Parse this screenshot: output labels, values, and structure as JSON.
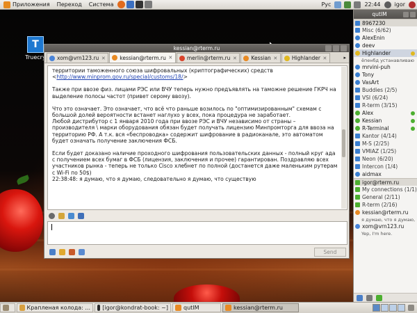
{
  "top_panel": {
    "menus": [
      "Приложения",
      "Переход",
      "Система"
    ],
    "keyboard_layout": "Рус",
    "clock": "22:44",
    "user": "igor"
  },
  "desktop": {
    "icon_label": "Truecry"
  },
  "chat": {
    "window_title": "kessian@rterm.ru",
    "tabs": [
      {
        "label": "xom@vrn123.ru",
        "icon_color": "#4a84d8"
      },
      {
        "label": "kessian@rterm.ru",
        "icon_color": "#e88a24"
      },
      {
        "label": "merlin@rterm.ru",
        "icon_color": "#d9442c"
      },
      {
        "label": "Kessian",
        "icon_color": "#e88a24"
      },
      {
        "label": "Highlander",
        "icon_color": "#e0b820"
      }
    ],
    "log": {
      "p1_pre": "территории таможенного союза шифровальных (криптографических) средств <",
      "p1_link": "http://www.minprom.gov.ru/special/customs/18/",
      "p1_post": ">",
      "p2": "Также при ввозе физ. лицами РЭС или ВЧУ теперь нужно предъявлять на таможне решение ГКРЧ на выделение полосы частот (привет серому ввозу).",
      "p3": "Что это означает. Это означает, что всё что раньше возилось по \"оптимизированным\" схемам с большой долей вероятности встанет наглухо у всех, пока процедура не заработает.",
      "p3b": "Любой дистрибутор с 1 января 2010 года при ввозе РЭС и ВЧУ независимо от страны – производителя \\ марки оборудования обязан будет получать лицензию Минпромторга для ввоза на территорию РФ. А т.к. вся «беспроводка» содержит шифрование в радиоканале, это автоматом будет означать получение заключения ФСБ.",
      "p4": "Если будет доказано наличие проходного шифрования пользовательских данных - полный круг ада с получением всех бумаг в ФСБ (лицензия, заключения и прочее) гарантирован. Поздравляю всех участников рынка - теперь не только Cisco хлебнет по полной (достанется даже маленьким рутерам с Wi-Fi по 50$)",
      "last_line": "22:38:48: я думаю, что я думаю, следовательно я думаю, что существую"
    },
    "send_label": "Send"
  },
  "roster": {
    "title": "qutIM",
    "rows": [
      {
        "kind": "acct",
        "text": "8967230",
        "icon": "#3a7fd0"
      },
      {
        "kind": "grp",
        "text": "Misc (6/62)",
        "icon": "#3a7fd0"
      },
      {
        "kind": "contact",
        "text": "AlexEnin",
        "icon": "#3a7fd0"
      },
      {
        "kind": "contact",
        "text": "deev",
        "icon": "#3a7fd0"
      },
      {
        "kind": "contact-sel",
        "text": "Highlander",
        "icon": "#e0b820",
        "right": "#e0b820"
      },
      {
        "kind": "sub",
        "text": "ёпенбд устанавливаю"
      },
      {
        "kind": "contact",
        "text": "mrvini-puh",
        "icon": "#3a7fd0"
      },
      {
        "kind": "contact",
        "text": "Tony",
        "icon": "#3a7fd0"
      },
      {
        "kind": "contact",
        "text": "VasArt",
        "icon": "#3a7fd0"
      },
      {
        "kind": "grp",
        "text": "Buddies (2/5)",
        "icon": "#3a7fd0"
      },
      {
        "kind": "grp",
        "text": "VSI (6/24)",
        "icon": "#3a7fd0"
      },
      {
        "kind": "grp",
        "text": "R-term (3/15)",
        "icon": "#3a7fd0"
      },
      {
        "kind": "contact",
        "text": "Alex",
        "icon": "#4caf30",
        "right": "#4caf30"
      },
      {
        "kind": "contact",
        "text": "Kessian",
        "icon": "#4caf30",
        "right": "#4caf30"
      },
      {
        "kind": "contact",
        "text": "R-Terminal",
        "icon": "#4caf30",
        "right": "#4caf30"
      },
      {
        "kind": "grp",
        "text": "Kantor (4/14)",
        "icon": "#3a7fd0"
      },
      {
        "kind": "grp",
        "text": "M-S (2/25)",
        "icon": "#3a7fd0"
      },
      {
        "kind": "grp",
        "text": "VMIAZ (1/25)",
        "icon": "#3a7fd0"
      },
      {
        "kind": "grp",
        "text": "Neon (6/20)",
        "icon": "#3a7fd0"
      },
      {
        "kind": "grp",
        "text": "Intercon (1/4)",
        "icon": "#3a7fd0"
      },
      {
        "kind": "contact",
        "text": "aidmax",
        "icon": "#3a7fd0"
      },
      {
        "kind": "acct",
        "text": "igor@rterm.ru",
        "icon": "#4caf30"
      },
      {
        "kind": "grp",
        "text": "My connections (1/1)",
        "icon": "#4caf30"
      },
      {
        "kind": "grp",
        "text": "General (2/11)",
        "icon": "#4caf30"
      },
      {
        "kind": "grp",
        "text": "R-term (2/16)",
        "icon": "#4caf30"
      },
      {
        "kind": "contact",
        "text": "kessian@rterm.ru",
        "icon": "#e88a24"
      },
      {
        "kind": "sub",
        "text": "я думаю, что я думаю,"
      },
      {
        "kind": "contact",
        "text": "xom@vrn123.ru",
        "icon": "#4a84d8"
      },
      {
        "kind": "sub",
        "text": "Yep, I'm here."
      }
    ]
  },
  "taskbar": {
    "items": [
      {
        "label": "Крапленая колода: ...",
        "icon_color": "#d8a040"
      },
      {
        "label": "[igor@kondrat-book: ~]",
        "icon_color": "#2b2b2b"
      },
      {
        "label": "qutIM",
        "icon_color": "#e88a24"
      },
      {
        "label": "kessian@rterm.ru",
        "icon_color": "#e88a24"
      }
    ]
  }
}
